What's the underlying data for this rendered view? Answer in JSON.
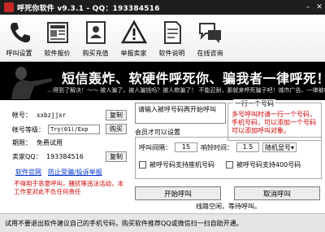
{
  "window": {
    "title": "呼死你软件 v9.3.1 - QQ：193384516",
    "minimize": "–",
    "close": "✕"
  },
  "toolbar": {
    "items": [
      {
        "label": "呼叫设置",
        "icon": "phone-icon"
      },
      {
        "label": "软件报价",
        "icon": "newspaper-icon"
      },
      {
        "label": "购买充值",
        "icon": "id-card-icon"
      },
      {
        "label": "举报卖家",
        "icon": "warning-triangle-icon"
      },
      {
        "label": "软件说明",
        "icon": "document-icon"
      },
      {
        "label": "在线咨询",
        "icon": "chat-bubbles-icon"
      }
    ]
  },
  "banner": {
    "headline": "短信轰炸、软硬件呼死你、骗我者一律呼死！",
    "marquee": "…得到了解决！～～ 被人骗了，被人骗钱吗？被人欺骗了！ 不能忍耐，那就来呼死骗子吧！城市广告、一律被呼叫。"
  },
  "account": {
    "id_label": "帐号：",
    "id_value": "xxbzjjxr",
    "copy_btn": "复制",
    "level_label": "帐号等级：",
    "level_value": "Try(01)/Exp",
    "buy_btn": "购买",
    "expire_label": "期限：",
    "expire_value": "免费试用",
    "seller_label": "卖家QQ：",
    "seller_value": "193384516",
    "copy_btn2": "复制",
    "link_home": "软件官网",
    "link_report": "防止受骗/投诉举报",
    "warning": "不得用于恶意呼叫，骚扰等违法活动，本工作室对此不负任何责任"
  },
  "call": {
    "input_placeholder": "请输入被呼号码再开始呼叫",
    "group_legend": "一行一个号码",
    "group_note": "多号呼叫时请一行一个号码，手机号码，可以添加一个号码可以添加呼叫对象。",
    "member_title": "会员才可以设置",
    "interval_label": "呼叫间隔：",
    "interval_value": "15",
    "ring_label": "响铃时间：",
    "ring_value": "1.5",
    "mode_value": "随机显号",
    "opt_mobile": "被呼号码支持座机号码",
    "opt_400": "被呼号码支持400号码",
    "start_btn": "开始呼叫",
    "cancel_btn": "取消呼叫",
    "status": "线路空闲，等待呼叫。"
  },
  "footer": {
    "text": "试用不要退出软件建议自己的手机号码，购买软件推荐QQ或微信扫一扫自助开通。"
  }
}
